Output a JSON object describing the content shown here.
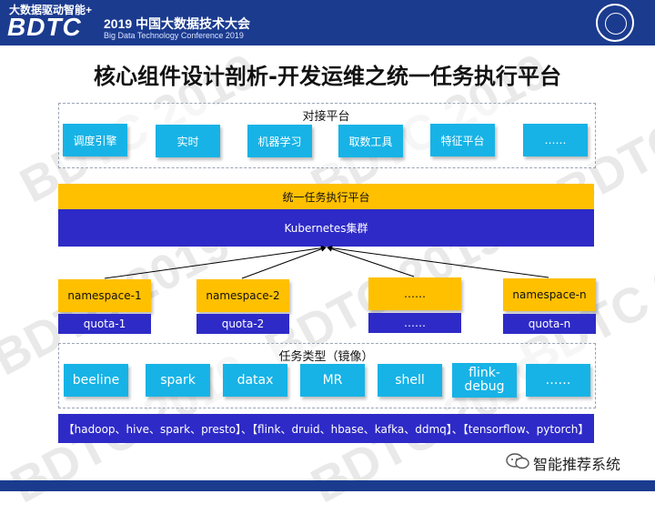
{
  "header": {
    "tagline": "大数据驱动智能+",
    "logo": "BDTC",
    "conference": "2019 中国大数据技术大会",
    "conference_en": "Big Data Technology Conference 2019"
  },
  "title": "核心组件设计剖析-开发运维之统一任务执行平台",
  "watermark": "BDTC 2019",
  "platforms": {
    "label": "对接平台",
    "items": [
      "调度引擎",
      "实时",
      "机器学习",
      "取数工具",
      "特征平台",
      "……"
    ]
  },
  "unified_bar": "统一任务执行平台",
  "k8s_bar": "Kubernetes集群",
  "namespaces": [
    {
      "name": "namespace-1",
      "quota": "quota-1"
    },
    {
      "name": "namespace-2",
      "quota": "quota-2"
    },
    {
      "name": "……",
      "quota": "……"
    },
    {
      "name": "namespace-n",
      "quota": "quota-n"
    }
  ],
  "task_types": {
    "label": "任务类型（镜像）",
    "items": [
      "beeline",
      "spark",
      "datax",
      "MR",
      "shell",
      "flink-debug",
      "……"
    ]
  },
  "footer_bar": "【hadoop、hive、spark、presto】、【flink、druid、hbase、kafka、ddmq】、【tensorflow、pytorch】",
  "wechat_label": "智能推荐系统",
  "colors": {
    "header": "#1b3b8f",
    "cyan": "#17b3e6",
    "yellow": "#ffc000",
    "blue": "#2e2ac7"
  }
}
